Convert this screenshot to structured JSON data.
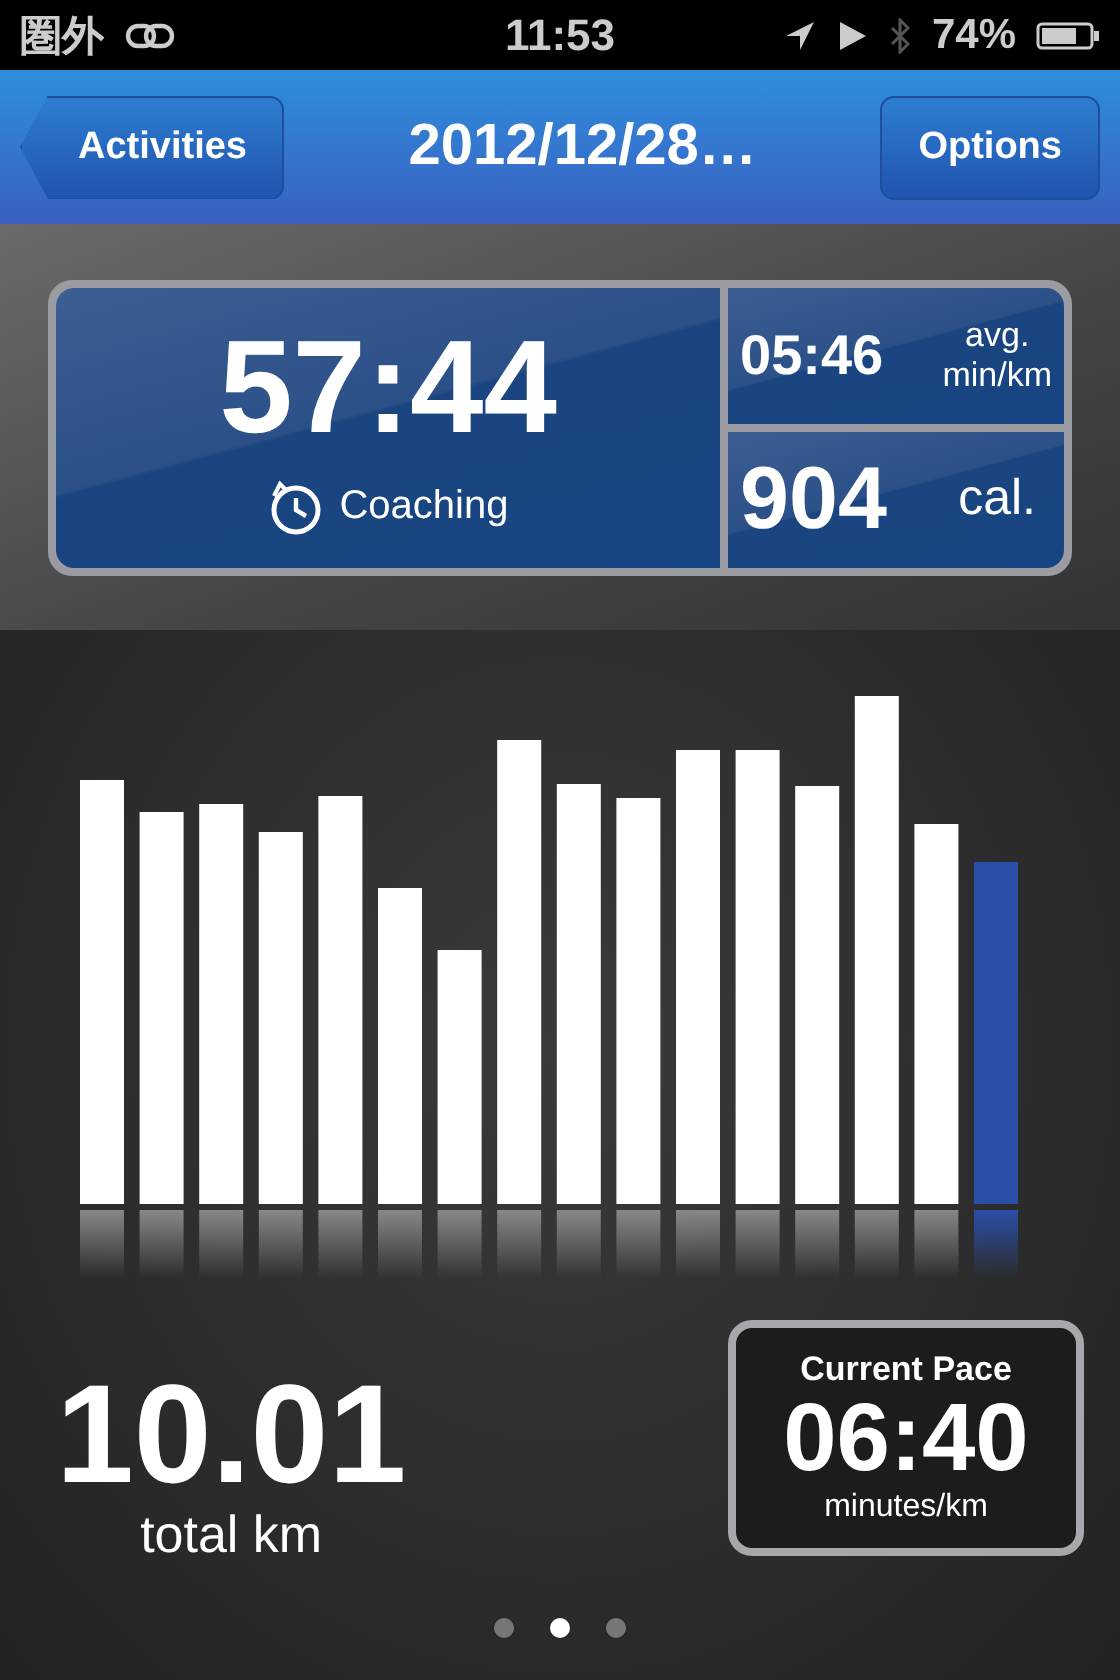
{
  "status_bar": {
    "carrier": "圏外",
    "time": "11:53",
    "battery": "74%"
  },
  "nav_bar": {
    "back_button": "Activities",
    "title": "2012/12/28…",
    "right_button": "Options"
  },
  "summary": {
    "duration": "57:44",
    "coaching": "Coaching",
    "avg_pace": "05:46",
    "avg_label": "avg.",
    "avg_unit": "min/km",
    "calories": "904",
    "calories_unit": "cal."
  },
  "distance": {
    "value": "10.01",
    "label": "total km"
  },
  "current_pace": {
    "title": "Current Pace",
    "value": "06:40",
    "unit": "minutes/km"
  },
  "pages": [
    {
      "selected": false
    },
    {
      "selected": true
    },
    {
      "selected": false
    }
  ]
}
